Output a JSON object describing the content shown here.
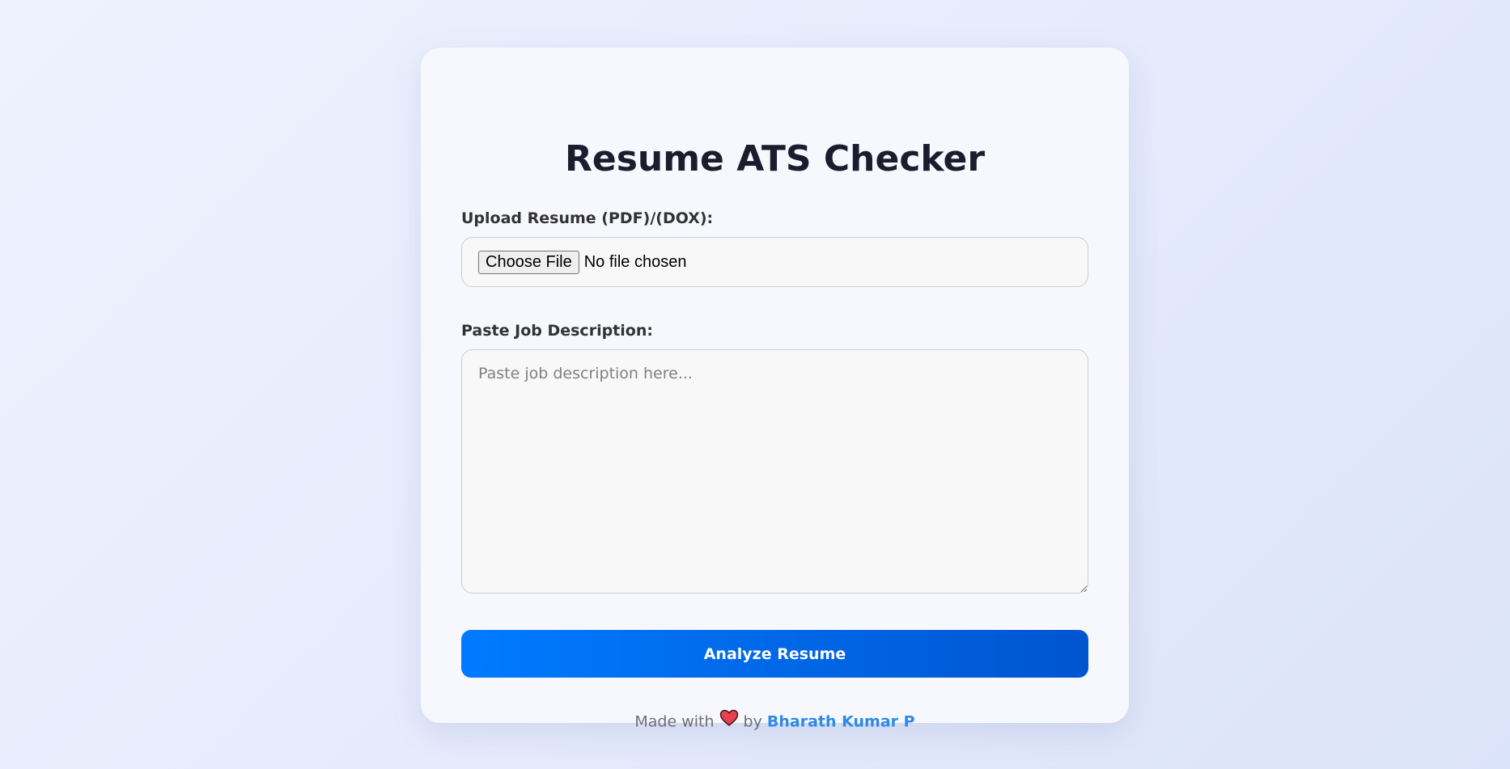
{
  "app": {
    "title": "Resume ATS Checker"
  },
  "upload": {
    "label": "Upload Resume (PDF)/(DOX):",
    "button_label": "Choose File",
    "status_text": "No file chosen"
  },
  "job_description": {
    "label": "Paste Job Description:",
    "placeholder": "Paste job description here...",
    "value": ""
  },
  "actions": {
    "analyze_label": "Analyze Resume"
  },
  "footer": {
    "made_with": "Made with",
    "heart_icon": "heart-icon",
    "by": "by",
    "author": "Bharath Kumar P"
  },
  "colors": {
    "accent": "#007bff",
    "accent_dark": "#0055d0",
    "link": "#2f8ae6",
    "heart": "#e8404f"
  }
}
